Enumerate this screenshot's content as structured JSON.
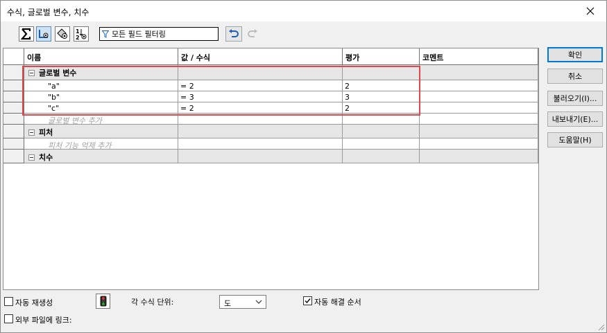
{
  "window": {
    "title": "수식, 글로벌 변수, 치수"
  },
  "toolbar": {
    "buttons": [
      {
        "icon": "sigma-formula-icon"
      },
      {
        "icon": "view-folder-icon"
      },
      {
        "icon": "tags-eye-icon"
      },
      {
        "icon": "sort-order-eye-icon"
      }
    ],
    "filter_placeholder": "모든 필드 필터링"
  },
  "grid": {
    "columns": [
      "이름",
      "값 / 수식",
      "평가",
      "코멘트"
    ],
    "groups": {
      "global": {
        "name": "글로벌 변수",
        "add_hint": "글로벌 변수 추가"
      },
      "feature": {
        "name": "피처",
        "add_hint": "피처 기능 억제 추가"
      },
      "dimension": {
        "name": "치수"
      }
    },
    "rows": [
      {
        "name": "\"a\"",
        "value": "= 2",
        "eval": "2",
        "comment": ""
      },
      {
        "name": "\"b\"",
        "value": "= 3",
        "eval": "3",
        "comment": ""
      },
      {
        "name": "\"c\"",
        "value": "= 2",
        "eval": "2",
        "comment": ""
      }
    ]
  },
  "buttons": {
    "ok": "확인",
    "cancel": "취소",
    "import": "불러오기(I)...",
    "export": "내보내기(E)...",
    "help": "도움말(H)"
  },
  "bottom": {
    "auto_rebuild": "자동 재생성",
    "link_external": "외부 파일에 링크:",
    "angle_units_label": "각 수식 단위:",
    "angle_units_value": "도",
    "auto_solve_order": "자동 해결 순서",
    "auto_rebuild_checked": false,
    "link_external_checked": false,
    "auto_solve_order_checked": true
  }
}
